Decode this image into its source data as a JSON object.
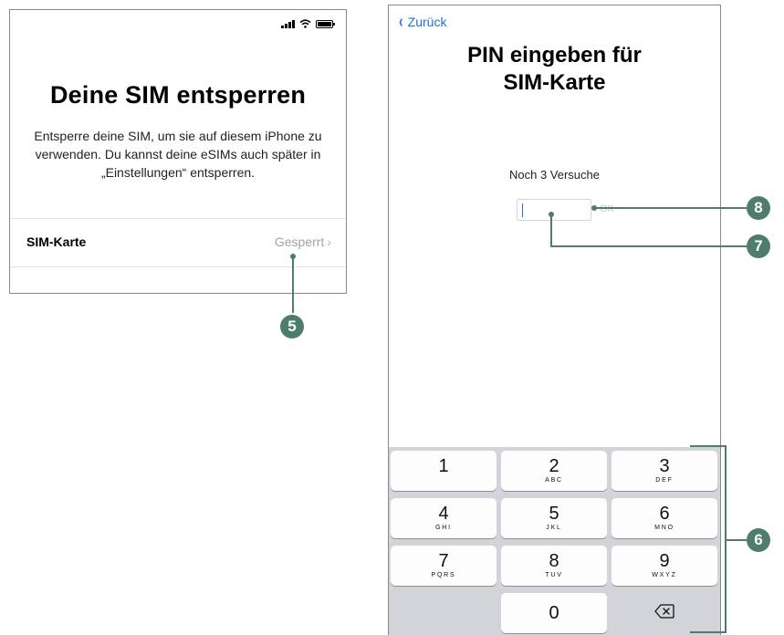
{
  "left_screen": {
    "title": "Deine SIM entsperren",
    "description": "Entsperre deine SIM, um sie auf diesem iPhone zu verwenden. Du kannst deine eSIMs auch später in „Einstellungen“ entsperren.",
    "sim_row": {
      "label": "SIM-Karte",
      "status": "Gesperrt",
      "chevron": "›"
    }
  },
  "right_screen": {
    "back_label": "Zurück",
    "back_chevron": "‹",
    "title_line1": "PIN eingeben für",
    "title_line2": "SIM-Karte",
    "attempts": "Noch 3 Versuche",
    "pin_value": "",
    "ok_label": "OK",
    "keypad": [
      {
        "digit": "1",
        "letters": ""
      },
      {
        "digit": "2",
        "letters": "ABC"
      },
      {
        "digit": "3",
        "letters": "DEF"
      },
      {
        "digit": "4",
        "letters": "GHI"
      },
      {
        "digit": "5",
        "letters": "JKL"
      },
      {
        "digit": "6",
        "letters": "MNO"
      },
      {
        "digit": "7",
        "letters": "PQRS"
      },
      {
        "digit": "8",
        "letters": "TUV"
      },
      {
        "digit": "9",
        "letters": "WXYZ"
      },
      {
        "digit": "0",
        "letters": ""
      }
    ]
  },
  "callouts": {
    "c5": "5",
    "c6": "6",
    "c7": "7",
    "c8": "8"
  },
  "colors": {
    "callout": "#4e7d6e",
    "link": "#1e6fd9",
    "keypad_bg": "#d3d4d9"
  }
}
